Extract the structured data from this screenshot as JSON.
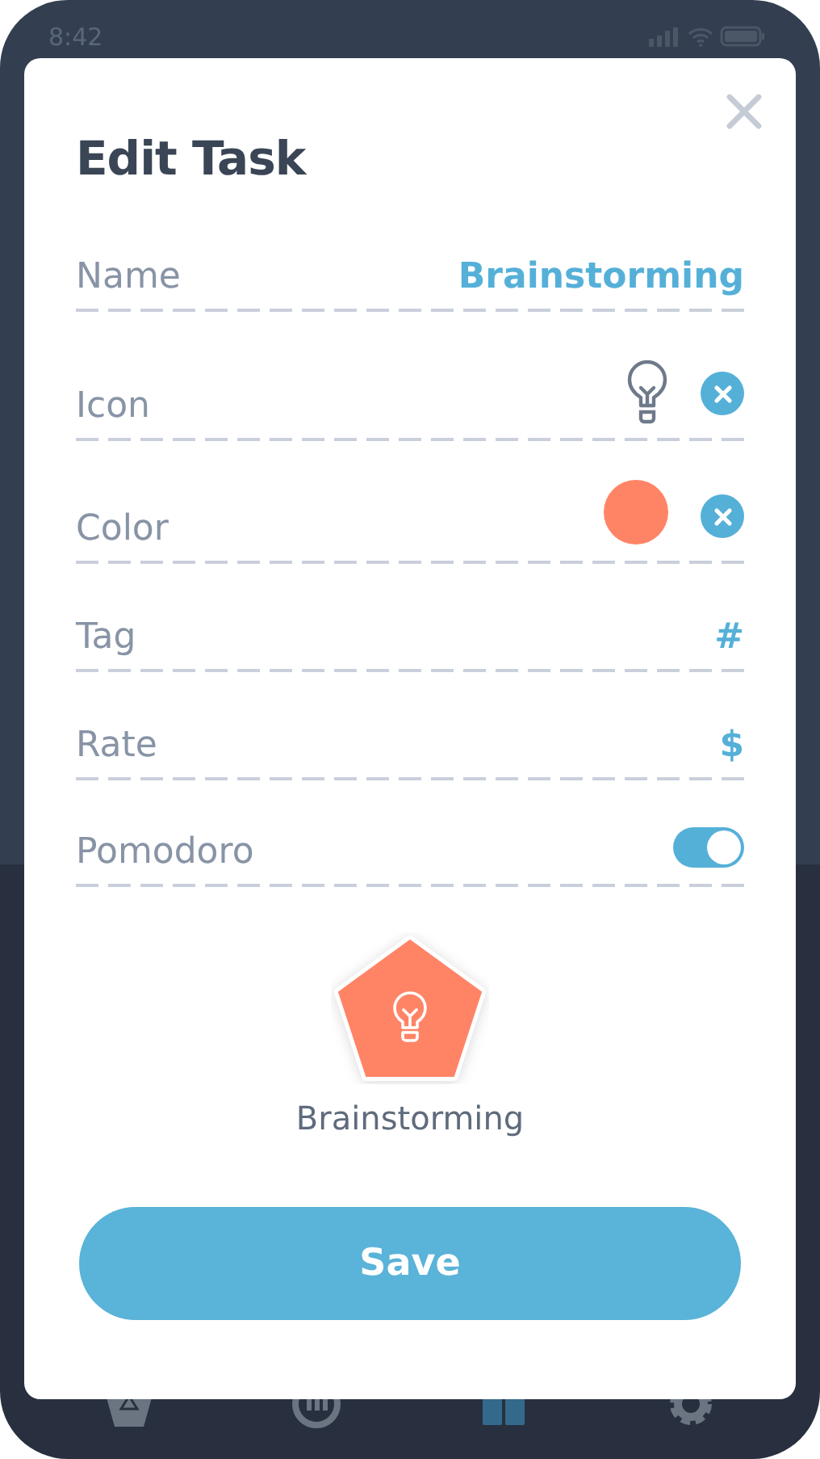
{
  "status_bar": {
    "time": "8:42"
  },
  "dialog": {
    "title": "Edit Task",
    "fields": [
      {
        "kind": "text",
        "label": "Name",
        "value": "Brainstorming"
      },
      {
        "kind": "icon",
        "label": "Icon",
        "clearable": true
      },
      {
        "kind": "color",
        "label": "Color",
        "color": "#ff8466",
        "clearable": true
      },
      {
        "kind": "symbol",
        "label": "Tag",
        "value": "#"
      },
      {
        "kind": "symbol",
        "label": "Rate",
        "value": "$"
      },
      {
        "kind": "toggle",
        "label": "Pomodoro",
        "on": true
      }
    ],
    "preview": {
      "label": "Brainstorming",
      "color": "#ff8466"
    },
    "save_button": "Save"
  },
  "bottom_nav": [
    {
      "kind": "pentagon",
      "selected": false
    },
    {
      "kind": "chart",
      "selected": false
    },
    {
      "kind": "grid",
      "selected": true
    },
    {
      "kind": "gear",
      "selected": false
    }
  ]
}
